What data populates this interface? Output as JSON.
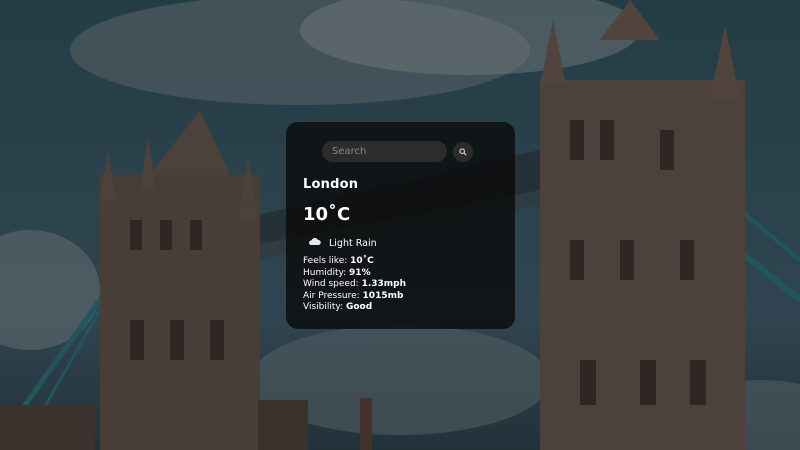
{
  "search": {
    "placeholder": "Search",
    "button_icon": "search-icon"
  },
  "weather": {
    "city": "London",
    "temperature": "10˚C",
    "condition": {
      "icon": "cloud-icon",
      "label": "Light Rain"
    },
    "details": [
      {
        "label": "Feels like: ",
        "value": "10˚C"
      },
      {
        "label": "Humidity: ",
        "value": "91%"
      },
      {
        "label": "Wind speed: ",
        "value": "1.33mph"
      },
      {
        "label": "Air Pressure: ",
        "value": "1015mb"
      },
      {
        "label": "Visibility: ",
        "value": "Good"
      }
    ]
  },
  "colors": {
    "card_bg": "#0a0a0a",
    "text": "#ffffff",
    "input_bg": "#2c2c2c"
  }
}
